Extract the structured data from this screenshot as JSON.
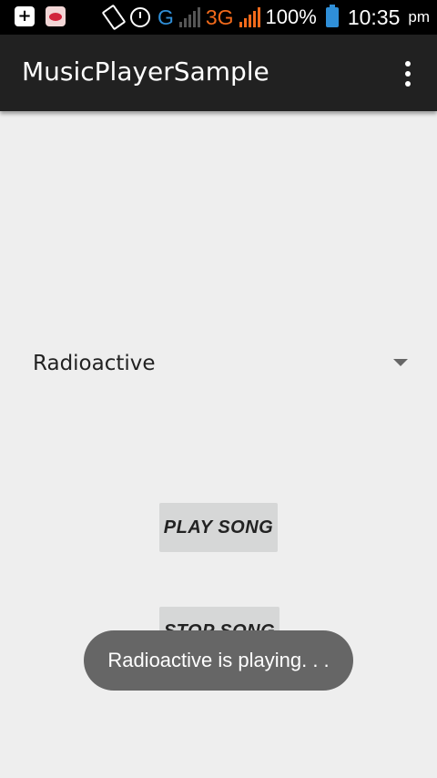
{
  "status_bar": {
    "icons": [
      "add-notification-icon",
      "lips-app-notification-icon",
      "vibrate-icon",
      "alarm-icon",
      "signal-icon",
      "battery-icon"
    ],
    "network_g": "G",
    "network_3g": "3G",
    "battery": "100%",
    "time": "10:35",
    "ampm": "pm",
    "colors": {
      "g": "#2f8fd8",
      "threeg": "#f26a1b",
      "battery": "#2f8fd8"
    }
  },
  "action_bar": {
    "title": "MusicPlayerSample",
    "background": "#212121"
  },
  "spinner": {
    "selected": "Radioactive"
  },
  "buttons": {
    "play": "PLAY SONG",
    "stop": "STOP SONG"
  },
  "toast": {
    "message": "Radioactive is playing. . ."
  }
}
